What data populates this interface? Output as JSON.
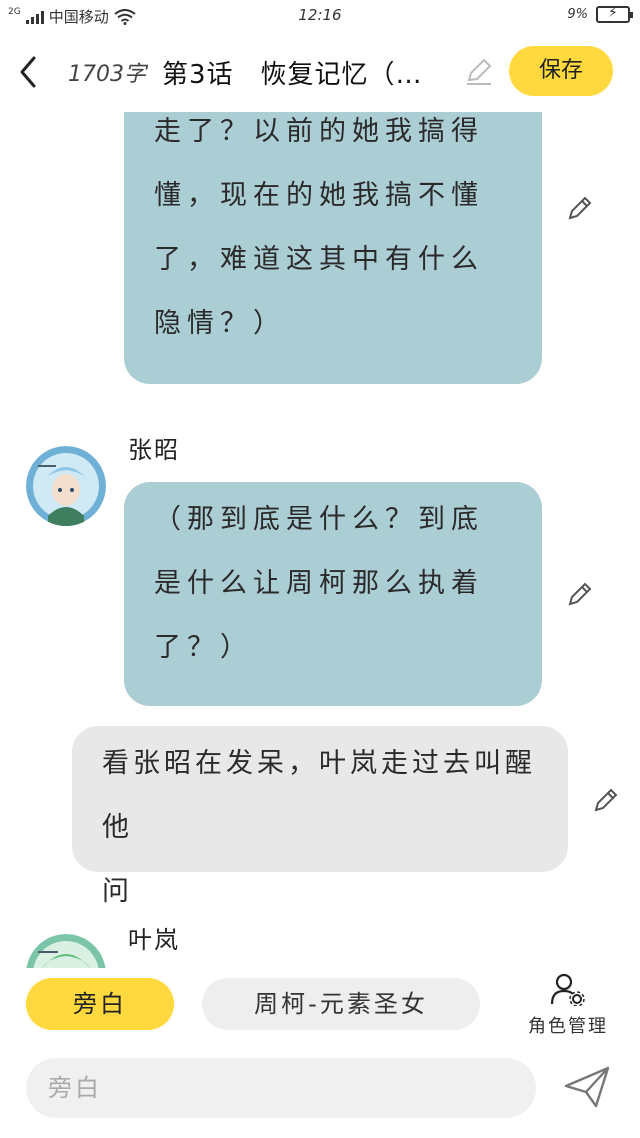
{
  "status_bar": {
    "network": "2G",
    "carrier": "中国移动",
    "time": "12:16",
    "battery_percent": "9%"
  },
  "header": {
    "word_count": "1703字",
    "title": "第3话　恢复记忆（…",
    "save_label": "保存"
  },
  "messages": [
    {
      "type": "character",
      "text": "走了？以前的她我搞得懂，现在的她我搞不懂了，难道这其中有什么隐情？）",
      "lines": [
        "走了？以前的她我搞得",
        "懂，现在的她我搞不懂",
        "了，难道这其中有什么",
        "隐情？）"
      ]
    },
    {
      "type": "character",
      "speaker": "张昭",
      "text": "（那到底是什么？到底是什么让周柯那么执着了？）",
      "lines": [
        "（那到底是什么？到底",
        "是什么让周柯那么执着",
        "了？）"
      ]
    },
    {
      "type": "narration",
      "text": "看张昭在发呆，叶岚走过去叫醒他问",
      "lines": [
        "看张昭在发呆，叶岚走过去叫醒他",
        "问"
      ]
    },
    {
      "type": "character",
      "speaker": "叶岚"
    }
  ],
  "role_bar": {
    "narration_label": "旁白",
    "character_label": "周柯-元素圣女",
    "manage_label": "角色管理"
  },
  "input": {
    "placeholder": "旁白"
  },
  "colors": {
    "accent": "#ffd93d",
    "character_bubble": "#abcdd4",
    "narration_bubble": "#e8e8e8"
  }
}
